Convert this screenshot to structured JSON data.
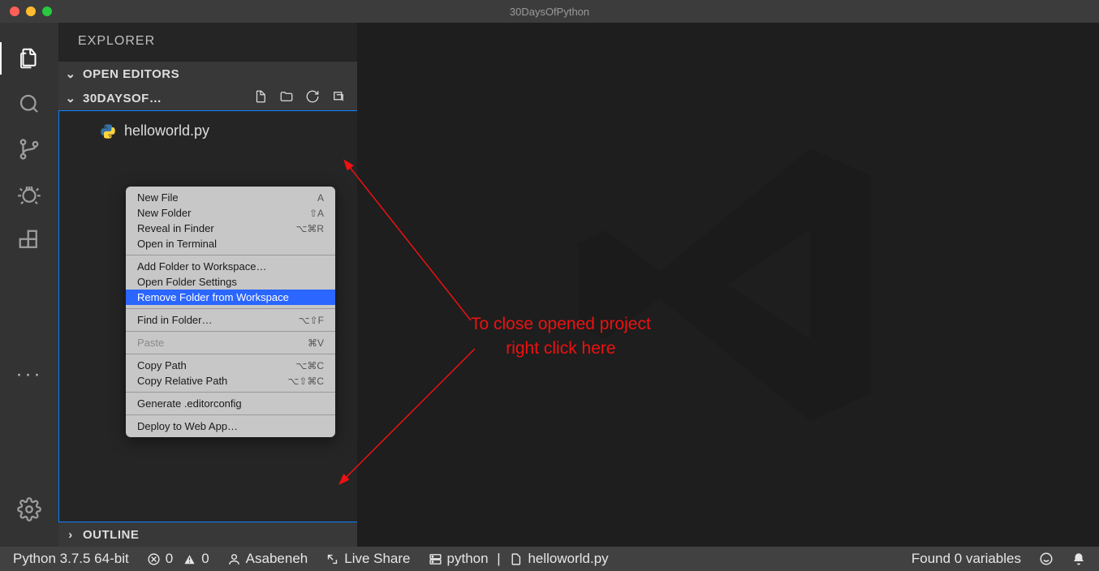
{
  "titlebar": {
    "title": "30DaysOfPython"
  },
  "activity": {
    "items": [
      "explorer",
      "search",
      "source-control",
      "debug",
      "extensions"
    ],
    "active": "explorer"
  },
  "sidebar": {
    "title": "EXPLORER",
    "open_editors_label": "OPEN EDITORS",
    "project_label": "30DAYSOF…",
    "outline_label": "OUTLINE",
    "files": [
      {
        "name": "helloworld.py",
        "icon": "python"
      }
    ]
  },
  "context_menu": {
    "groups": [
      [
        {
          "label": "New File",
          "shortcut": "A"
        },
        {
          "label": "New Folder",
          "shortcut": "⇧A"
        },
        {
          "label": "Reveal in Finder",
          "shortcut": "⌥⌘R"
        },
        {
          "label": "Open in Terminal",
          "shortcut": ""
        }
      ],
      [
        {
          "label": "Add Folder to Workspace…",
          "shortcut": ""
        },
        {
          "label": "Open Folder Settings",
          "shortcut": ""
        },
        {
          "label": "Remove Folder from Workspace",
          "shortcut": "",
          "highlight": true
        }
      ],
      [
        {
          "label": "Find in Folder…",
          "shortcut": "⌥⇧F"
        }
      ],
      [
        {
          "label": "Paste",
          "shortcut": "⌘V",
          "disabled": true
        }
      ],
      [
        {
          "label": "Copy Path",
          "shortcut": "⌥⌘C"
        },
        {
          "label": "Copy Relative Path",
          "shortcut": "⌥⇧⌘C"
        }
      ],
      [
        {
          "label": "Generate .editorconfig",
          "shortcut": ""
        }
      ],
      [
        {
          "label": "Deploy to Web App…",
          "shortcut": ""
        }
      ]
    ]
  },
  "annotation": {
    "line1": "To close opened project",
    "line2": "right click here"
  },
  "status": {
    "python": "Python 3.7.5 64-bit",
    "errors": "0",
    "warnings": "0",
    "user": "Asabeneh",
    "live_share": "Live Share",
    "kernel": "python",
    "file": "helloworld.py",
    "variables": "Found 0 variables"
  }
}
